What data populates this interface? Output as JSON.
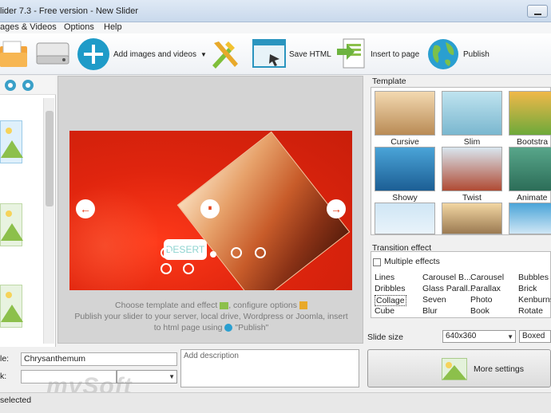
{
  "window": {
    "title": "lider 7.3 - Free version - New Slider"
  },
  "menu": [
    "ages & Videos",
    "Options",
    "Help"
  ],
  "toolbar": {
    "add_images": "Add images and videos",
    "save_html": "Save HTML",
    "insert_page": "Insert to page",
    "publish": "Publish"
  },
  "slide": {
    "caption": "DESERT",
    "prev_glyph": "←",
    "next_glyph": "→",
    "pause_glyph": "⏸"
  },
  "hint": {
    "line1": "Choose template and effect",
    "line1b": ", configure options",
    "line2": "Publish your slider to your server, local drive, Wordpress or Joomla, insert",
    "line3": "to html page using",
    "line3b": "\"Publish\""
  },
  "template_section": {
    "label": "Template",
    "items": [
      "Cursive",
      "Slim",
      "Bootstra",
      "Showy",
      "Twist",
      "Animate"
    ]
  },
  "effect_section": {
    "label": "Transition effect",
    "multiple": "Multiple effects",
    "columns": [
      [
        "Lines",
        "Dribbles",
        "Collage",
        "Cube"
      ],
      [
        "Carousel B...",
        "Glass Parall...",
        "Seven",
        "Blur"
      ],
      [
        "Carousel",
        "Parallax",
        "Photo",
        "Book"
      ],
      [
        "Bubbles",
        "Brick",
        "Kenburns",
        "Rotate"
      ]
    ],
    "selected": "Collage"
  },
  "slide_size": {
    "label": "Slide size",
    "value": "640x360",
    "mode": "Boxed"
  },
  "more_settings": "More settings",
  "properties": {
    "title_label": "le:",
    "title_value": "Chrysanthemum",
    "link_label": "k:",
    "desc_placeholder": "Add description"
  },
  "status": "selected",
  "watermark": "mySoft",
  "colors": {
    "accent": "#3aa0c8",
    "slide_red": "#e0250e",
    "caption_teal": "#8dd3d0"
  }
}
